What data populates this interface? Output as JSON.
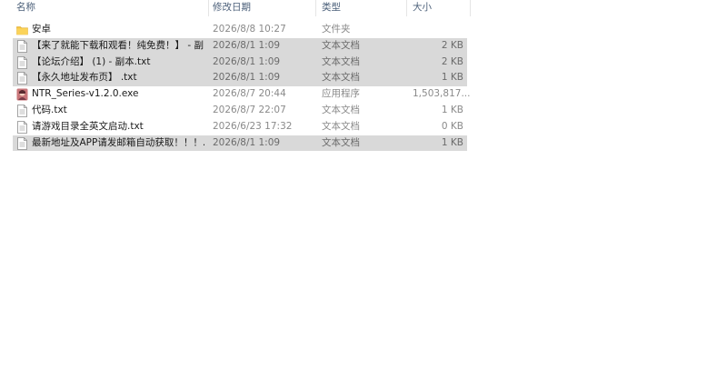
{
  "columns": {
    "name": "名称",
    "date": "修改日期",
    "type": "类型",
    "size": "大小"
  },
  "files": [
    {
      "name": "安卓",
      "date": "2026/8/8 10:27",
      "type": "文件夹",
      "size": "",
      "icon": "folder-icon",
      "selected": false
    },
    {
      "name": "【来了就能下载和观看！纯免费！】 - 副...",
      "date": "2026/8/1 1:09",
      "type": "文本文档",
      "size": "2 KB",
      "icon": "text-file-icon",
      "selected": true
    },
    {
      "name": "【论坛介绍】 (1) - 副本.txt",
      "date": "2026/8/1 1:09",
      "type": "文本文档",
      "size": "2 KB",
      "icon": "text-file-icon",
      "selected": true
    },
    {
      "name": "【永久地址发布页】 .txt",
      "date": "2026/8/1 1:09",
      "type": "文本文档",
      "size": "1 KB",
      "icon": "text-file-icon",
      "selected": true
    },
    {
      "name": "NTR_Series-v1.2.0.exe",
      "date": "2026/8/7 20:44",
      "type": "应用程序",
      "size": "1,503,817...",
      "icon": "application-icon",
      "selected": false
    },
    {
      "name": "代码.txt",
      "date": "2026/8/7 22:07",
      "type": "文本文档",
      "size": "1 KB",
      "icon": "text-file-icon",
      "selected": false
    },
    {
      "name": "请游戏目录全英文启动.txt",
      "date": "2026/6/23 17:32",
      "type": "文本文档",
      "size": "0 KB",
      "icon": "text-file-icon",
      "selected": false
    },
    {
      "name": "最新地址及APP请发邮箱自动获取！！！...",
      "date": "2026/8/1 1:09",
      "type": "文本文档",
      "size": "1 KB",
      "icon": "text-file-icon",
      "selected": true
    }
  ],
  "colors": {
    "header_text": "#4c607a",
    "selected_bg": "#d9d9d9",
    "folder": "#f6c23e"
  }
}
